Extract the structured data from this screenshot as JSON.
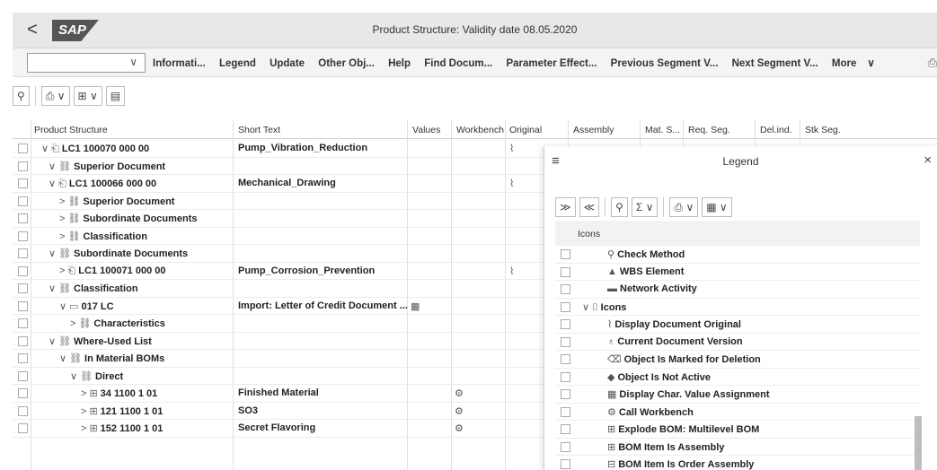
{
  "titlebar": {
    "back": "<",
    "logo": "SAP",
    "title": "Product Structure: Validity date 08.05.2020"
  },
  "toolbar": {
    "select_value": "",
    "items": [
      "Informati...",
      "Legend",
      "Update",
      "Other Obj...",
      "Help",
      "Find Docum...",
      "Parameter Effect...",
      "Previous Segment V...",
      "Next Segment V...",
      "More"
    ]
  },
  "grid": {
    "columns": [
      "Product Structure",
      "Short Text",
      "Values",
      "Workbench",
      "Original",
      "Assembly",
      "Mat. S...",
      "Req. Seg.",
      "Del.ind.",
      "Stk Seg."
    ],
    "rows": [
      {
        "arrow": "∨",
        "icon": "⎗",
        "label": "LC1 100070 000 00",
        "short": "Pump_Vibration_Reduction",
        "orig": "⌇"
      },
      {
        "arrow": "∨",
        "icon": "⛓",
        "label": "Superior Document",
        "short": ""
      },
      {
        "arrow": "∨",
        "icon": "⎗",
        "label": "LC1 100066 000 00",
        "short": "Mechanical_Drawing",
        "orig": "⌇"
      },
      {
        "arrow": ">",
        "icon": "⛓",
        "label": "Superior Document",
        "short": ""
      },
      {
        "arrow": ">",
        "icon": "⛓",
        "label": "Subordinate Documents",
        "short": ""
      },
      {
        "arrow": ">",
        "icon": "⛓",
        "label": "Classification",
        "short": ""
      },
      {
        "arrow": "∨",
        "icon": "⛓",
        "label": "Subordinate Documents",
        "short": ""
      },
      {
        "arrow": ">",
        "icon": "⎗",
        "label": "LC1 100071 000 00",
        "short": "Pump_Corrosion_Prevention",
        "orig": "⌇"
      },
      {
        "arrow": "∨",
        "icon": "⛓",
        "label": "Classification",
        "short": ""
      },
      {
        "arrow": "∨",
        "icon": "▭",
        "label": "017 LC",
        "short": "Import: Letter of Credit Document ...",
        "val": "▦"
      },
      {
        "arrow": ">",
        "icon": "⛓",
        "label": "Characteristics",
        "short": ""
      },
      {
        "arrow": "∨",
        "icon": "⛓",
        "label": "Where-Used List",
        "short": ""
      },
      {
        "arrow": "∨",
        "icon": "⛓",
        "label": "In Material BOMs",
        "short": ""
      },
      {
        "arrow": "∨",
        "icon": "⛓",
        "label": "Direct",
        "short": ""
      },
      {
        "arrow": ">",
        "icon": "⊞",
        "label": "34 1100 1 01",
        "short": "Finished Material",
        "wb": "⚙"
      },
      {
        "arrow": ">",
        "icon": "⊞",
        "label": "121 1100 1 01",
        "short": "SO3",
        "wb": "⚙"
      },
      {
        "arrow": ">",
        "icon": "⊞",
        "label": "152 1100 1 01",
        "short": "Secret Flavoring",
        "wb": "⚙"
      }
    ]
  },
  "legend": {
    "menu": "≡",
    "title": "Legend",
    "close": "×",
    "column_header": "Icons",
    "rows": [
      {
        "icon": "⚲",
        "label": "Check Method"
      },
      {
        "icon": "▲",
        "label": "WBS Element"
      },
      {
        "icon": "▬",
        "label": "Network Activity"
      },
      {
        "icon": "⌷",
        "label": "Icons",
        "arrow": "∨"
      },
      {
        "icon": "⌇",
        "label": "Display Document Original"
      },
      {
        "icon": "♁",
        "label": "Current Document Version"
      },
      {
        "icon": "⌫",
        "label": "Object Is Marked for Deletion"
      },
      {
        "icon": "◆",
        "label": "Object Is Not Active"
      },
      {
        "icon": "▦",
        "label": "Display Char. Value Assignment"
      },
      {
        "icon": "⚙",
        "label": "Call Workbench"
      },
      {
        "icon": "⊞",
        "label": "Explode BOM: Multilevel BOM"
      },
      {
        "icon": "⊞",
        "label": "BOM Item Is Assembly"
      },
      {
        "icon": "⊟",
        "label": "BOM Item Is Order Assembly"
      }
    ]
  }
}
